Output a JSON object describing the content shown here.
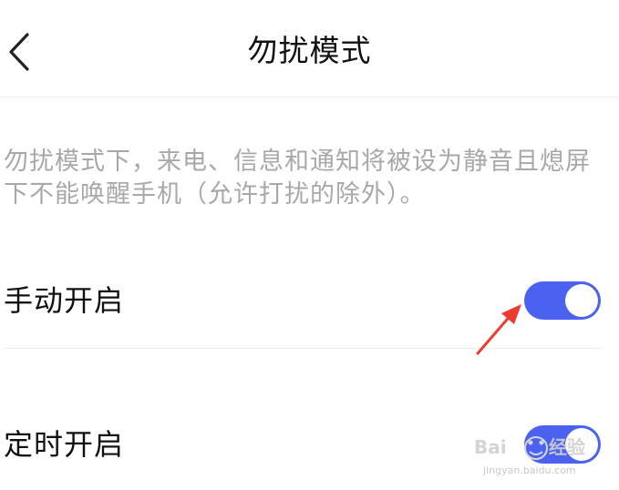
{
  "header": {
    "title": "勿扰模式",
    "back_icon": "chevron-left-icon"
  },
  "description": "勿扰模式下，来电、信息和通知将被设为静音且熄屏下不能唤醒手机（允许打扰的除外）。",
  "settings": [
    {
      "label": "手动开启",
      "enabled": true
    },
    {
      "label": "定时开启",
      "enabled": true
    }
  ],
  "colors": {
    "accent": "#4a62ef",
    "annotation_arrow": "#ee3b2f",
    "description_text": "#a8a8a8"
  },
  "watermark": {
    "brand": "Baidu经验",
    "url": "jingyan.baidu.com"
  }
}
